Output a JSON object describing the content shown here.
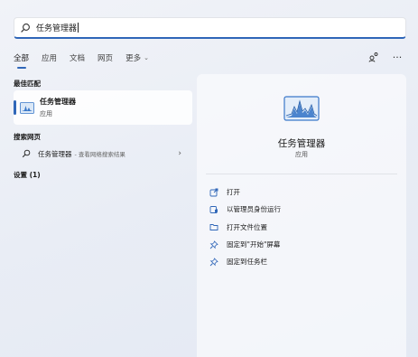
{
  "search": {
    "query": "任务管理器"
  },
  "tabs": [
    {
      "label": "全部",
      "active": true
    },
    {
      "label": "应用",
      "active": false
    },
    {
      "label": "文档",
      "active": false
    },
    {
      "label": "网页",
      "active": false
    },
    {
      "label": "更多",
      "active": false
    }
  ],
  "top_icons": {
    "share": "share-icon",
    "more": "···"
  },
  "best_match": {
    "heading": "最佳匹配",
    "name": "任务管理器",
    "type": "应用"
  },
  "web": {
    "heading": "搜索网页",
    "name": "任务管理器",
    "sub": "- 查看网络搜索结果"
  },
  "settings": {
    "heading": "设置 (1)"
  },
  "detail": {
    "title": "任务管理器",
    "subtitle": "应用",
    "actions": [
      {
        "label": "打开",
        "icon": "open-icon"
      },
      {
        "label": "以管理员身份运行",
        "icon": "admin-shield-icon"
      },
      {
        "label": "打开文件位置",
        "icon": "folder-icon"
      },
      {
        "label": "固定到\"开始\"屏幕",
        "icon": "pin-icon"
      },
      {
        "label": "固定到任务栏",
        "icon": "pin-icon"
      }
    ]
  },
  "colors": {
    "accent": "#2f66b8",
    "icon_blue": "#3a78c9"
  }
}
